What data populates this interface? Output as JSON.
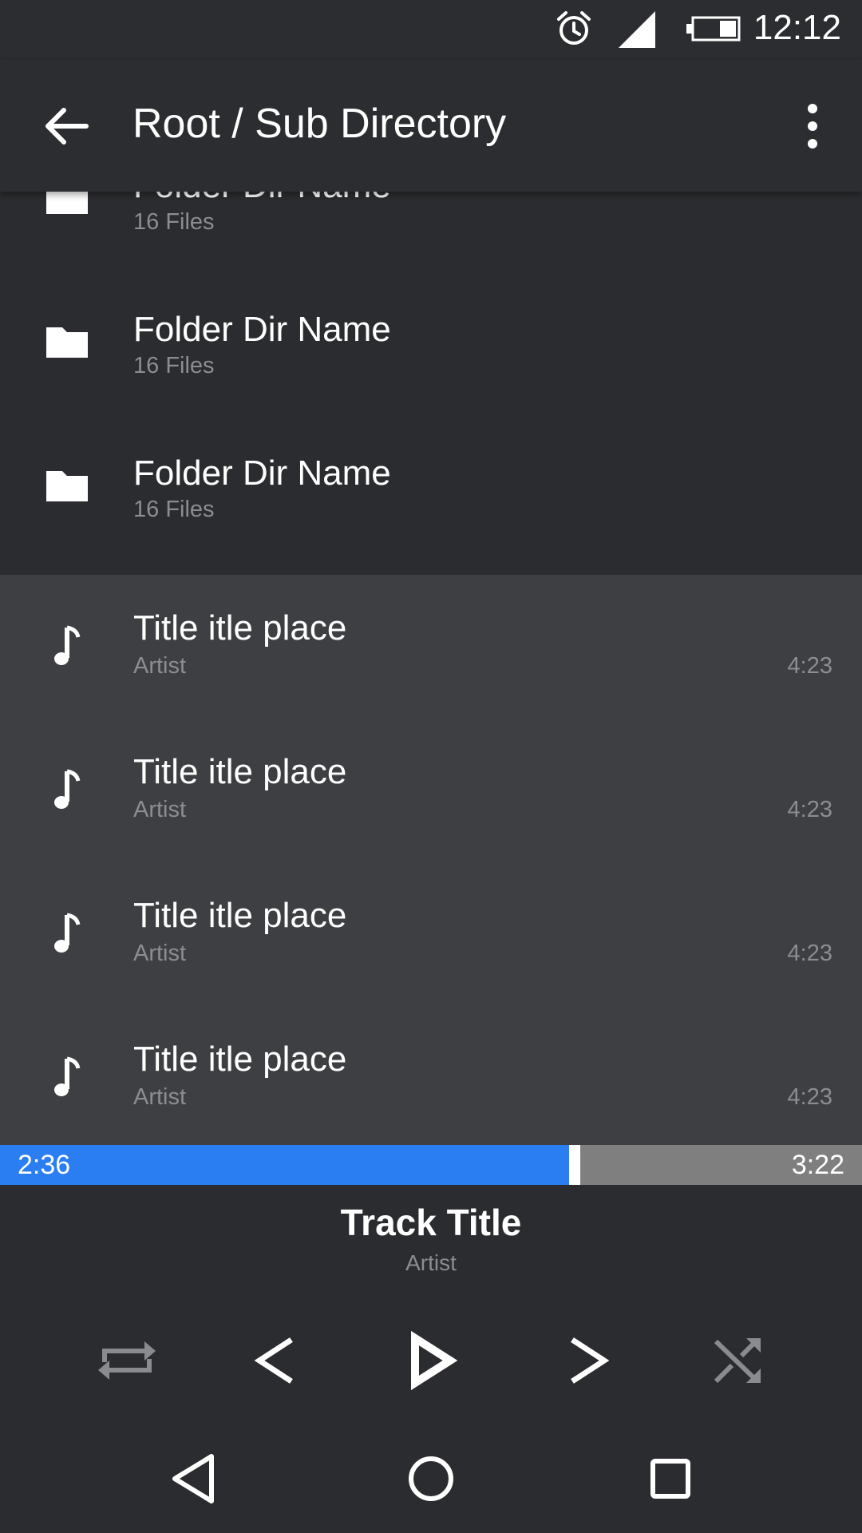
{
  "status_bar": {
    "time": "12:12",
    "icons": [
      "alarm-icon",
      "signal-icon",
      "battery-icon"
    ]
  },
  "app_bar": {
    "title": "Root / Sub Directory",
    "back_icon": "arrow-left-icon",
    "menu_icon": "more-vert-icon"
  },
  "folders": [
    {
      "name": "Folder Dir Name",
      "count": "16 Files"
    },
    {
      "name": "Folder Dir Name",
      "count": "16 Files"
    },
    {
      "name": "Folder Dir Name",
      "count": "16 Files"
    }
  ],
  "tracks": [
    {
      "title": "Title itle place",
      "artist": "Artist",
      "duration": "4:23"
    },
    {
      "title": "Title itle place",
      "artist": "Artist",
      "duration": "4:23"
    },
    {
      "title": "Title itle place",
      "artist": "Artist",
      "duration": "4:23"
    },
    {
      "title": "Title itle place",
      "artist": "Artist",
      "duration": "4:23"
    }
  ],
  "player": {
    "elapsed": "2:36",
    "total": "3:22",
    "progress_fraction": 0.66,
    "track_title": "Track Title",
    "artist": "Artist",
    "controls": [
      "repeat-icon",
      "previous-icon",
      "play-icon",
      "next-icon",
      "shuffle-icon"
    ]
  },
  "nav_bar": {
    "icons": [
      "nav-back-icon",
      "nav-home-icon",
      "nav-recents-icon"
    ]
  },
  "colors": {
    "background": "#2b2c2f",
    "track_row": "#3e3f42",
    "accent": "#2a7ef1",
    "progress_track": "#7f7f7f",
    "secondary_text": "#8c8d90"
  }
}
